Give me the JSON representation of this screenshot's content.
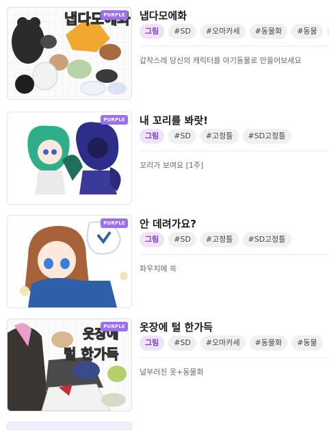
{
  "items": [
    {
      "title": "냅다모에화",
      "badge": "PURPLE",
      "thumb_text": "냅다모에화",
      "tags": [
        "그림",
        "#SD",
        "#오마카세",
        "#동물화",
        "#동물",
        "#"
      ],
      "description": "갑작스레 당신의 캐릭터를 아기동물로 만들어보세요"
    },
    {
      "title": "내 꼬리를 봐랏!",
      "badge": "PURPLE",
      "tags": [
        "그림",
        "#SD",
        "#고정틀",
        "#SD고정틀"
      ],
      "description": "꼬리가 보여요 [1주]"
    },
    {
      "title": "안 데려가요?",
      "badge": "PURPLE",
      "tags": [
        "그림",
        "#SD",
        "#고정틀",
        "#SD고정틀"
      ],
      "description": "파우치에 쏙"
    },
    {
      "title": "옷장에 털 한가득",
      "badge": "PURPLE",
      "thumb_text_1": "옷장에",
      "thumb_text_2": "털 한가득",
      "tags": [
        "그림",
        "#SD",
        "#오마카세",
        "#동물화",
        "#동물"
      ],
      "description": "널부러진 옷+동물화"
    }
  ],
  "colors": {
    "accent": "#9c6ff2",
    "tag_main_bg": "#efe3fb",
    "tag_main_text": "#7b3fc4"
  }
}
